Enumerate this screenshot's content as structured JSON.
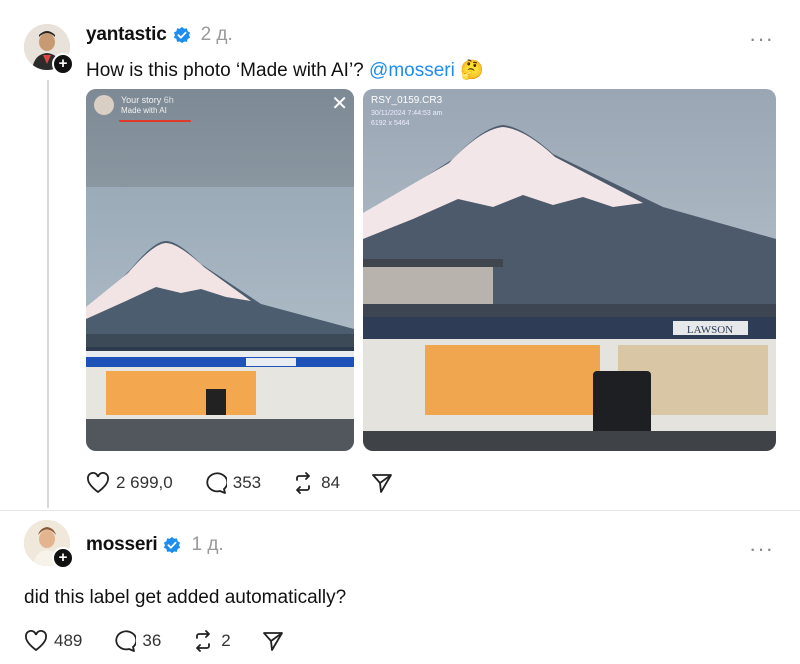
{
  "post1": {
    "username": "yantastic",
    "time": "2 д.",
    "more": "···",
    "text_before": "How is this photo ‘Made with AI’? ",
    "mention": "@mosseri",
    "emoji": "🤔",
    "story_overlay": {
      "name": "Your story",
      "age": "6h",
      "label": "Made with AI",
      "close": "✕"
    },
    "raw_file": {
      "name": "RSY_0159.CR3",
      "meta_line1": "30/11/2024 7:44:53 am",
      "meta_line2": "6192 x 5464"
    },
    "store_sign": "LAWSON",
    "actions": {
      "likes": "2 699,0",
      "comments": "353",
      "reposts": "84"
    }
  },
  "post2": {
    "username": "mosseri",
    "time": "1 д.",
    "more": "···",
    "text": "did this label get added automatically?",
    "actions": {
      "likes": "489",
      "comments": "36",
      "reposts": "2"
    }
  },
  "colors": {
    "verified": "#1d8df0",
    "mention": "#1d8df0",
    "ai_underline": "#e03a2b"
  },
  "icons": [
    "heart-icon",
    "comment-icon",
    "repost-icon",
    "share-icon",
    "verified-icon",
    "plus-icon",
    "more-icon",
    "close-icon"
  ]
}
